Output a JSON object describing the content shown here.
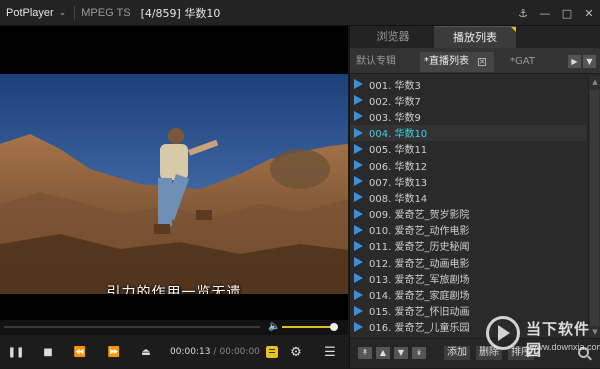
{
  "titlebar": {
    "app_name": "PotPlayer",
    "format": "MPEG TS",
    "title": "[4/859] 华数10"
  },
  "video": {
    "subtitle": "引力的作用一览无遗"
  },
  "controls": {
    "current_time": "00:00:13",
    "separator": "/",
    "total_time": "00:00:00",
    "volume_level": 0.9,
    "seek_progress": 0
  },
  "panel": {
    "tabs": [
      "浏览器",
      "播放列表"
    ],
    "subtabs": [
      "默认专辑",
      "*直播列表",
      "*GAT"
    ],
    "playlist": [
      {
        "label": "001. 华数3",
        "current": false
      },
      {
        "label": "002. 华数7",
        "current": false
      },
      {
        "label": "003. 华数9",
        "current": false
      },
      {
        "label": "004. 华数10",
        "current": true
      },
      {
        "label": "005. 华数11",
        "current": false
      },
      {
        "label": "006. 华数12",
        "current": false
      },
      {
        "label": "007. 华数13",
        "current": false
      },
      {
        "label": "008. 华数14",
        "current": false
      },
      {
        "label": "009. 爱奇艺_贺岁影院",
        "current": false
      },
      {
        "label": "010. 爱奇艺_动作电影",
        "current": false
      },
      {
        "label": "011. 爱奇艺_历史秘闻",
        "current": false
      },
      {
        "label": "012. 爱奇艺_动画电影",
        "current": false
      },
      {
        "label": "013. 爱奇艺_军旅剧场",
        "current": false
      },
      {
        "label": "014. 爱奇艺_家庭剧场",
        "current": false
      },
      {
        "label": "015. 爱奇艺_怀旧动画",
        "current": false
      },
      {
        "label": "016. 爱奇艺_儿童乐园",
        "current": false
      }
    ],
    "bottom": {
      "add": "添加",
      "delete": "删除",
      "sort": "排序"
    }
  },
  "watermark": {
    "title": "当下软件园",
    "url": "www.downxia.com"
  },
  "colors": {
    "accent": "#e6c019",
    "current_item": "#3fd0ea",
    "play_icon": "#3a8fe0"
  }
}
